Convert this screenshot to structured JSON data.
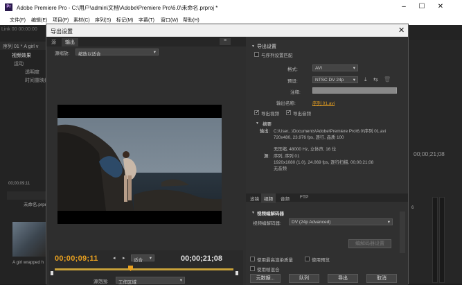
{
  "window": {
    "title": "Adobe Premiere Pro - C:\\用户\\admin\\文档\\Adobe\\Premiere Pro\\6.0\\未命名.prproj *",
    "logo": "Pr",
    "minimize": "–",
    "maximize": "☐",
    "close": "✕"
  },
  "menu": [
    "文件(F)",
    "编辑(E)",
    "项目(P)",
    "素材(C)",
    "序列(S)",
    "标记(M)",
    "字幕(T)",
    "窗口(W)",
    "帮助(H)"
  ],
  "bg": {
    "link_line": "Link 00 00:00:00",
    "seq_tab": "序列 01 * A girl v",
    "effects": "视频效果",
    "fx1": "运动",
    "fx2": "透明度",
    "fx3": "时间重映射",
    "timecode_small": "00;00;09;11",
    "project": "未命名.prpr",
    "clip_caption": "A girl wrapped h",
    "tc_right": "00;00;21;08",
    "num_6": "6"
  },
  "dialog": {
    "title": "导出设置",
    "close": "✕"
  },
  "left": {
    "tabs": [
      "源",
      "输出"
    ],
    "scale_label": "源缩放:",
    "scale_value": "缩放以适合",
    "timecode_current": "00;00;09;11",
    "timecode_total": "00;00;21;08",
    "fit_value": "适合",
    "range_label": "源范围:",
    "range_value": "工作区域"
  },
  "export": {
    "header": "导出设置",
    "match_seq": "与序列设置匹配",
    "format_label": "格式:",
    "format_value": "AVI",
    "preset_label": "预设:",
    "preset_value": "NTSC DV 24p",
    "comment_label": "注释:",
    "output_name_label": "输出名称:",
    "output_name": "序列 01.avi",
    "export_video": "导出视频",
    "export_audio": "导出音频",
    "summary_header": "摘要",
    "output_label": "输出:",
    "output_path": "C:\\User...\\Documents\\Adobe\\Premiere Pro\\6.0\\序列 01.avi",
    "output_l2": "720x480, 23.976 fps, 逐行, 品质 100",
    "output_l3": "无压缩, 48000 Hz, 立体声, 16 位",
    "source_label": "源:",
    "source_l1": "序列, 序列 01",
    "source_l2": "1920x1080 (1.0), 24.069 fps, 逐行扫描, 00;00;21;08",
    "source_l3": "无音频"
  },
  "codec": {
    "tabs": [
      "滤镜",
      "视频",
      "音频",
      "FTP"
    ],
    "header": "视频编解码器",
    "codec_label": "视频编解码器:",
    "codec_value": "DV (24p Advanced)",
    "settings_btn": "编解码器设置",
    "max_quality": "使用最高渲染质量",
    "use_preview": "使用预览",
    "frame_blend": "使用帧混合"
  },
  "buttons": {
    "metadata": "元数据...",
    "queue": "队列",
    "export": "导出",
    "cancel": "取消"
  },
  "colors": {
    "accent": "#e8a020",
    "dialog_bg": "#3c3c3c"
  }
}
